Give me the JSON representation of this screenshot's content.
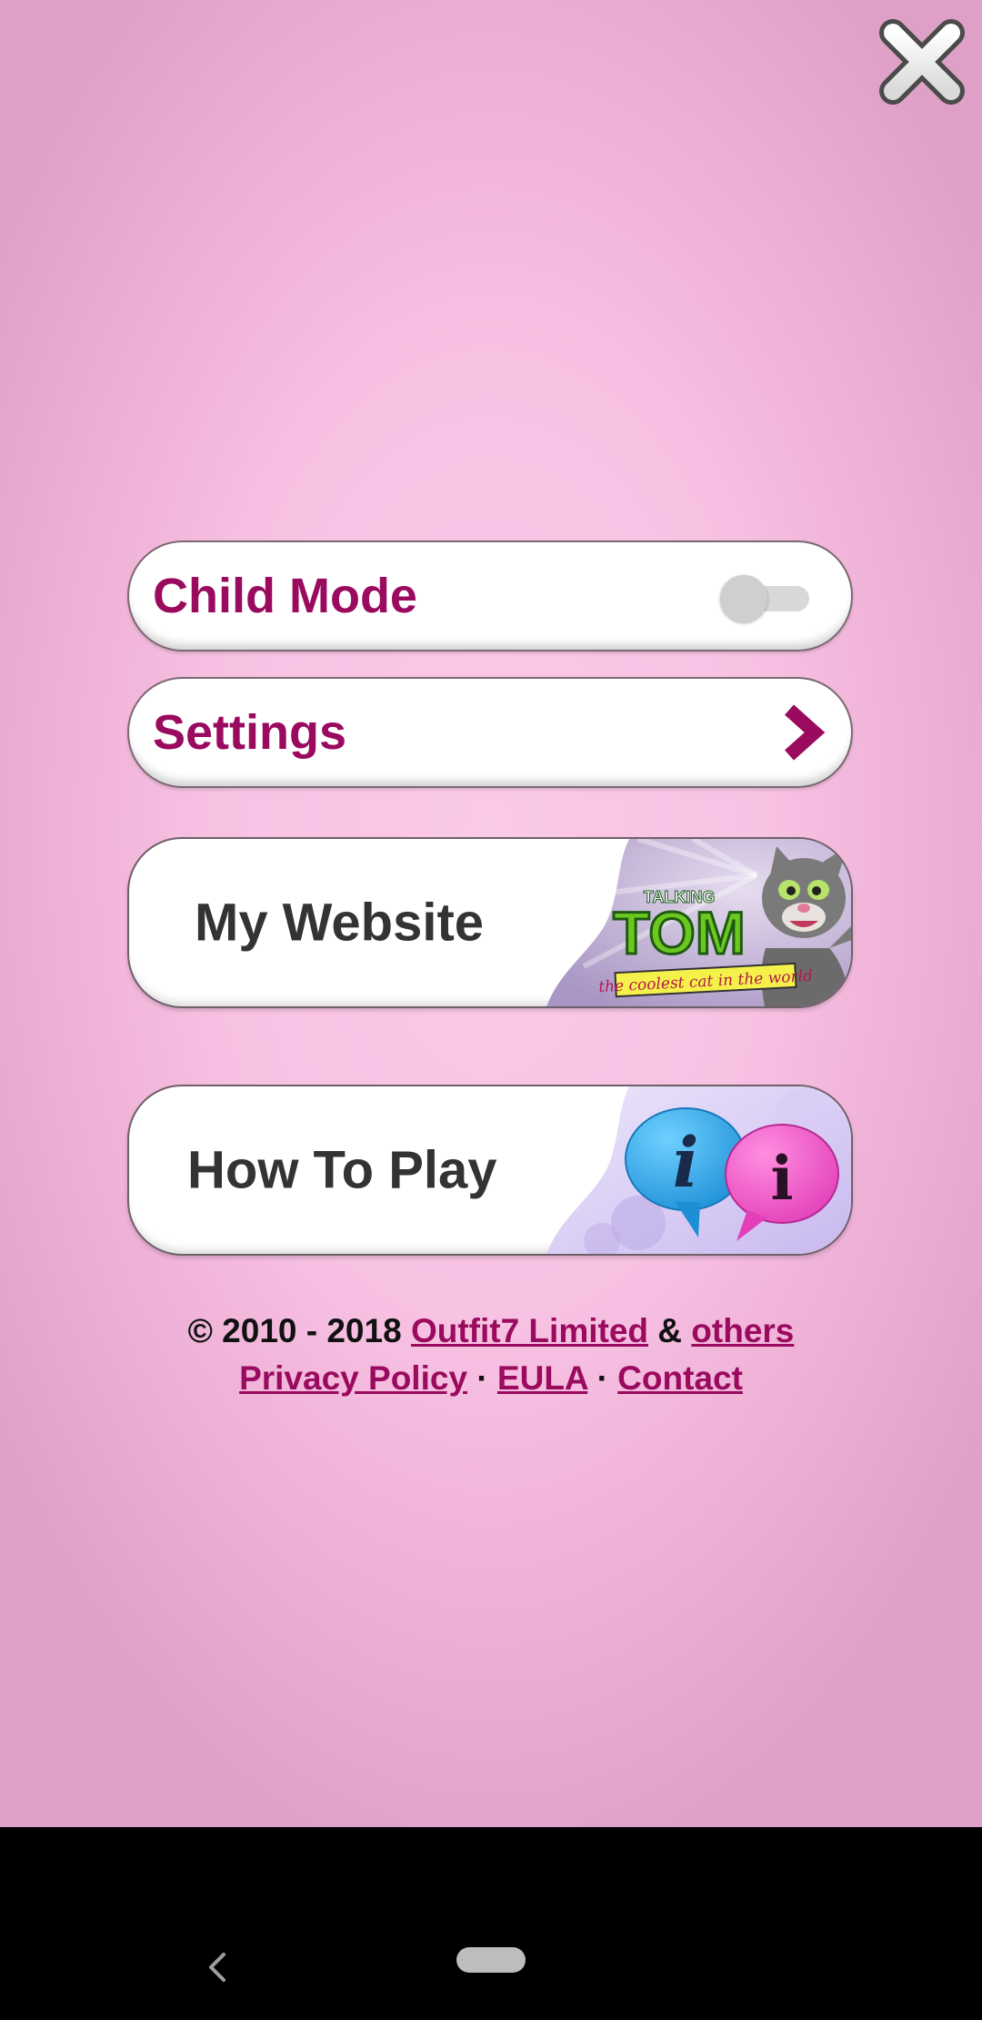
{
  "menu": {
    "child_mode": {
      "label": "Child Mode",
      "toggle_on": false
    },
    "settings": {
      "label": "Settings"
    }
  },
  "banners": {
    "my_website": {
      "label": "My Website",
      "art": {
        "small_text": "TALKING",
        "title": "TOM",
        "tagline": "the coolest cat in the world"
      }
    },
    "how_to_play": {
      "label": "How To Play",
      "bubble_glyph": "i"
    }
  },
  "footer": {
    "copyright": "© 2010 - 2018",
    "company_link": "Outfit7 Limited",
    "ampersand": "&",
    "others_link": "others",
    "privacy_link": "Privacy Policy",
    "separator": "·",
    "eula_link": "EULA",
    "contact_link": "Contact"
  },
  "colors": {
    "accent": "#9a0a5e",
    "background": "#f8c2e3",
    "button_text": "#333333"
  },
  "icons": {
    "close": "close-x-icon",
    "settings_arrow": "chevron-right-icon",
    "nav_back": "nav-back-icon"
  }
}
